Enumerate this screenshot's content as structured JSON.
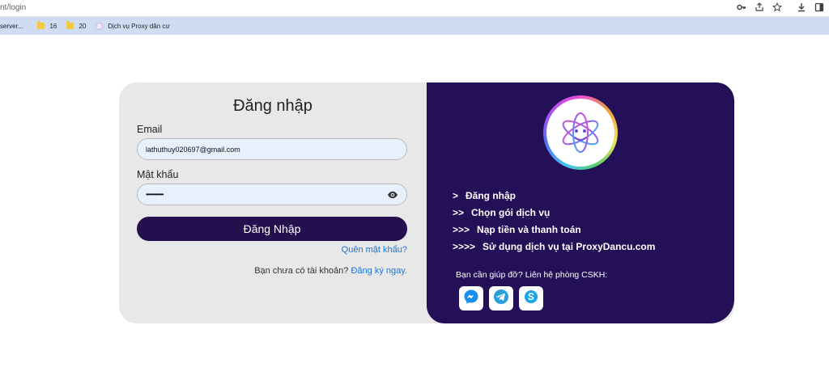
{
  "browser": {
    "url": "nt/login",
    "icons": [
      "key-icon",
      "share-icon",
      "star-icon",
      "download-icon",
      "sidepanel-icon"
    ]
  },
  "bookmarks": [
    {
      "label": "server...",
      "icon": "none"
    },
    {
      "label": "16",
      "icon": "folder-icon"
    },
    {
      "label": "20",
      "icon": "folder-icon"
    },
    {
      "label": "Dịch vụ Proxy dân cư",
      "icon": "globe-icon"
    }
  ],
  "login": {
    "title": "Đăng nhập",
    "email_label": "Email",
    "email_value": "lathuthuy020697@gmail.com",
    "password_label": "Mật khẩu",
    "password_value": "••••••••••••",
    "submit_label": "Đăng Nhập",
    "forgot_label": "Quên mật khẩu?",
    "signup_prompt": "Bạn chưa có tài khoản?",
    "signup_link": "Đăng ký ngay."
  },
  "info": {
    "steps": [
      {
        "arrows": ">",
        "text": "Đăng nhập"
      },
      {
        "arrows": ">>",
        "text": "Chọn gói dịch vụ"
      },
      {
        "arrows": ">>>",
        "text": "Nạp tiền và thanh toán"
      },
      {
        "arrows": ">>>>",
        "text": "Sử dụng dịch vụ tại ProxyDancu.com"
      }
    ],
    "help_text": "Bạn cần giúp đỡ? Liên hệ phòng CSKH:",
    "social": [
      "messenger-icon",
      "telegram-icon",
      "skype-icon"
    ]
  },
  "colors": {
    "panel_bg": "#231057",
    "button_bg": "#25104f",
    "link": "#1b74d3",
    "card_bg": "#e8e8e8",
    "bookmark_bar": "#cfddf3"
  }
}
